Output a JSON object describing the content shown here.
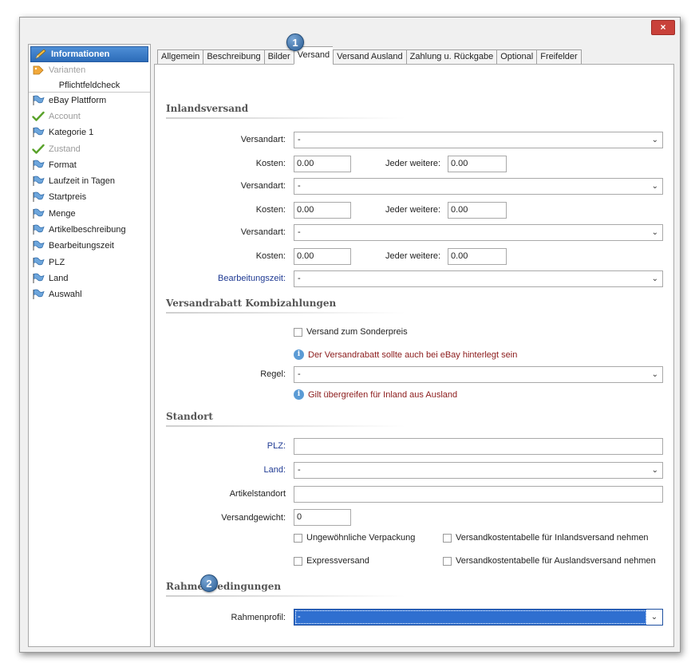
{
  "window": {
    "close_label": "×"
  },
  "sidebar": {
    "active_item": "Informationen",
    "disabled_item": "Varianten",
    "header": "Pflichtfeldcheck",
    "items": [
      {
        "label": "eBay Plattform",
        "icon": "flag-icon",
        "state": "normal"
      },
      {
        "label": "Account",
        "icon": "checkmark-icon",
        "state": "done"
      },
      {
        "label": "Kategorie 1",
        "icon": "flag-icon",
        "state": "normal"
      },
      {
        "label": "Zustand",
        "icon": "checkmark-icon",
        "state": "done"
      },
      {
        "label": "Format",
        "icon": "flag-icon",
        "state": "normal"
      },
      {
        "label": "Laufzeit in Tagen",
        "icon": "flag-icon",
        "state": "normal"
      },
      {
        "label": "Startpreis",
        "icon": "flag-icon",
        "state": "normal"
      },
      {
        "label": "Menge",
        "icon": "flag-icon",
        "state": "normal"
      },
      {
        "label": "Artikelbeschreibung",
        "icon": "flag-icon",
        "state": "normal"
      },
      {
        "label": "Bearbeitungszeit",
        "icon": "flag-icon",
        "state": "normal"
      },
      {
        "label": "PLZ",
        "icon": "flag-icon",
        "state": "normal"
      },
      {
        "label": "Land",
        "icon": "flag-icon",
        "state": "normal"
      },
      {
        "label": "Auswahl",
        "icon": "flag-icon",
        "state": "normal"
      }
    ]
  },
  "tabs": [
    "Allgemein",
    "Beschreibung",
    "Bilder",
    "Versand",
    "Versand Ausland",
    "Zahlung u. Rückgabe",
    "Optional",
    "Freifelder"
  ],
  "active_tab": "Versand",
  "badges": {
    "one": "1",
    "two": "2"
  },
  "inland": {
    "title": "Inlandsversand",
    "versandart_label": "Versandart:",
    "kosten_label": "Kosten:",
    "jeder_label": "Jeder weitere:",
    "rows": [
      {
        "versandart": "-",
        "kosten": "0.00",
        "jeder": "0.00"
      },
      {
        "versandart": "-",
        "kosten": "0.00",
        "jeder": "0.00"
      },
      {
        "versandart": "-",
        "kosten": "0.00",
        "jeder": "0.00"
      }
    ],
    "bearbeitungszeit_label": "Bearbeitungszeit:",
    "bearbeitungszeit_value": "-"
  },
  "rabatt": {
    "title": "Versandrabatt Kombizahlungen",
    "sonderpreis_label": "Versand zum Sonderpreis",
    "info1": "Der Versandrabatt sollte auch bei eBay hinterlegt sein",
    "regel_label": "Regel:",
    "regel_value": "-",
    "info2": "Gilt übergreifen für Inland aus Ausland"
  },
  "standort": {
    "title": "Standort",
    "plz_label": "PLZ:",
    "plz_value": "",
    "land_label": "Land:",
    "land_value": "-",
    "artikelstandort_label": "Artikelstandort",
    "artikelstandort_value": "",
    "versandgewicht_label": "Versandgewicht:",
    "versandgewicht_value": "0",
    "chk_verpackung": "Ungewöhnliche Verpackung",
    "chk_inlandstabelle": "Versandkostentabelle für Inlandsversand nehmen",
    "chk_express": "Expressversand",
    "chk_auslandstabelle": "Versandkostentabelle für Auslandsversand nehmen"
  },
  "rahmen": {
    "title": "Rahmenbedingungen",
    "profil_label": "Rahmenprofil:",
    "profil_value": "-"
  },
  "colors": {
    "accent": "#2c6cb9",
    "info_text": "#8b1a1a",
    "required_label": "#1f3a93",
    "close": "#c9413a"
  }
}
